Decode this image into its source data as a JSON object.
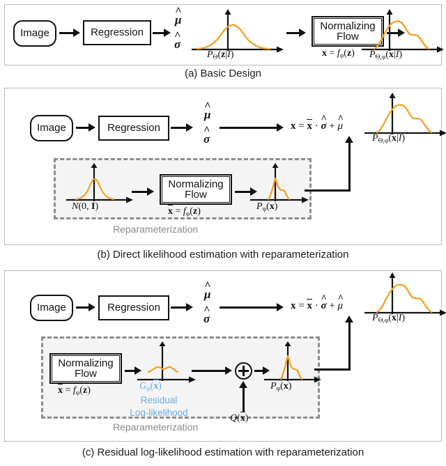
{
  "figure": {
    "panels": [
      {
        "id": "a",
        "caption": "(a) Basic Design",
        "nodes": {
          "image": "Image",
          "regression": "Regression",
          "flow_line1": "Normalizing",
          "flow_line2": "Flow"
        },
        "labels": {
          "mu_hat": "μ̂",
          "sigma_hat": "σ̂",
          "flow_eq": "x = f_φ(z)",
          "plot1_label": "P_Θ(z|I)",
          "plot2_label": "P_Θ,φ(x|I)"
        }
      },
      {
        "id": "b",
        "caption": "(b) Direct likelihood estimation with reparameterization",
        "nodes": {
          "image": "Image",
          "regression": "Regression",
          "flow_line1": "Normalizing",
          "flow_line2": "Flow"
        },
        "labels": {
          "mu_hat": "μ̂",
          "sigma_hat": "σ̂",
          "reparam_eq": "x = x̄ · σ̂ + μ̂",
          "plot_out_label": "P_Θ,φ(x|I)",
          "prior_label": "N(0, I)",
          "flow_eq": "x̄ = f_φ(z)",
          "plot_pphi_label": "P_φ(x̄)",
          "dashed_region": "Reparameterization"
        }
      },
      {
        "id": "c",
        "caption": "(c) Residual log-likelihood estimation with reparameterization",
        "nodes": {
          "image": "Image",
          "regression": "Regression",
          "flow_line1": "Normalizing",
          "flow_line2": "Flow"
        },
        "labels": {
          "mu_hat": "μ̂",
          "sigma_hat": "σ̂",
          "reparam_eq": "x = x̄ · σ̂ + μ̂",
          "plot_out_label": "P_Θ,φ(x|I)",
          "flow_eq": "x̄ = f_φ(z)",
          "g_label": "G_φ(x̄)",
          "residual_line1": "Residual",
          "residual_line2": "Log-likelihood",
          "q_label": "Q(x̄)",
          "plot_pphi_label": "P_φ(x̄)",
          "operator": "⊕",
          "dashed_region": "Reparameterization"
        }
      }
    ]
  },
  "colors": {
    "curve": "#f4a024",
    "blue_annotation": "#69ade2",
    "dashed_border": "#8d8d8d",
    "dashed_fill": "#f4f4f4",
    "panel_border": "#b9b9b9",
    "ink": "#111111"
  },
  "chart_data": {
    "type": "line",
    "title": "Probability density sketches inside the pipeline diagram",
    "plots": [
      {
        "name": "P_Theta(z|I)",
        "panel": "a",
        "shape": "broad unimodal gaussian",
        "x": [
          0,
          0.1,
          0.2,
          0.3,
          0.4,
          0.5,
          0.6,
          0.7,
          0.8,
          0.9,
          1.0
        ],
        "y": [
          0.02,
          0.06,
          0.16,
          0.36,
          0.65,
          0.88,
          0.92,
          0.72,
          0.4,
          0.15,
          0.03
        ]
      },
      {
        "name": "P_Theta,phi(x|I) (a)",
        "panel": "a",
        "shape": "multimodal bumpy",
        "x": [
          0,
          0.1,
          0.2,
          0.3,
          0.4,
          0.5,
          0.6,
          0.7,
          0.8,
          0.9,
          1.0
        ],
        "y": [
          0.02,
          0.1,
          0.35,
          0.7,
          0.92,
          0.97,
          0.78,
          0.62,
          0.7,
          0.35,
          0.05
        ]
      },
      {
        "name": "P_Theta,phi(x|I) (b)",
        "panel": "b",
        "shape": "multimodal bumpy",
        "x": [
          0,
          0.1,
          0.2,
          0.3,
          0.4,
          0.5,
          0.6,
          0.7,
          0.8,
          0.9,
          1.0
        ],
        "y": [
          0.02,
          0.1,
          0.35,
          0.7,
          0.92,
          0.97,
          0.78,
          0.62,
          0.7,
          0.35,
          0.05
        ]
      },
      {
        "name": "N(0, I)",
        "panel": "b",
        "shape": "narrow gaussian",
        "x": [
          0,
          0.15,
          0.3,
          0.4,
          0.5,
          0.6,
          0.7,
          0.85,
          1.0
        ],
        "y": [
          0.03,
          0.1,
          0.38,
          0.75,
          0.95,
          0.75,
          0.38,
          0.1,
          0.03
        ]
      },
      {
        "name": "P_phi(x_bar) (b)",
        "panel": "b",
        "shape": "narrow sharp peak with right shoulder",
        "x": [
          0,
          0.2,
          0.35,
          0.45,
          0.5,
          0.58,
          0.68,
          0.8,
          1.0
        ],
        "y": [
          0.02,
          0.05,
          0.3,
          0.8,
          0.98,
          0.55,
          0.48,
          0.12,
          0.02
        ]
      },
      {
        "name": "G_phi(x_bar)",
        "panel": "c",
        "shape": "low flat wavy residual",
        "x": [
          0,
          0.15,
          0.3,
          0.42,
          0.5,
          0.6,
          0.72,
          0.85,
          1.0
        ],
        "y": [
          0.06,
          0.1,
          0.22,
          0.26,
          0.2,
          0.26,
          0.2,
          0.12,
          0.06
        ]
      },
      {
        "name": "P_phi(x_bar) (c)",
        "panel": "c",
        "shape": "narrow sharp peak with right shoulder",
        "x": [
          0,
          0.2,
          0.35,
          0.45,
          0.5,
          0.58,
          0.68,
          0.8,
          1.0
        ],
        "y": [
          0.02,
          0.05,
          0.3,
          0.8,
          0.98,
          0.55,
          0.48,
          0.12,
          0.02
        ]
      },
      {
        "name": "P_Theta,phi(x|I) (c)",
        "panel": "c",
        "shape": "multimodal bumpy",
        "x": [
          0,
          0.1,
          0.2,
          0.3,
          0.4,
          0.5,
          0.6,
          0.7,
          0.8,
          0.9,
          1.0
        ],
        "y": [
          0.02,
          0.1,
          0.35,
          0.7,
          0.92,
          0.97,
          0.78,
          0.62,
          0.7,
          0.35,
          0.05
        ]
      }
    ],
    "xlabel": "",
    "ylabel": "",
    "grid": false,
    "legend": "none"
  }
}
